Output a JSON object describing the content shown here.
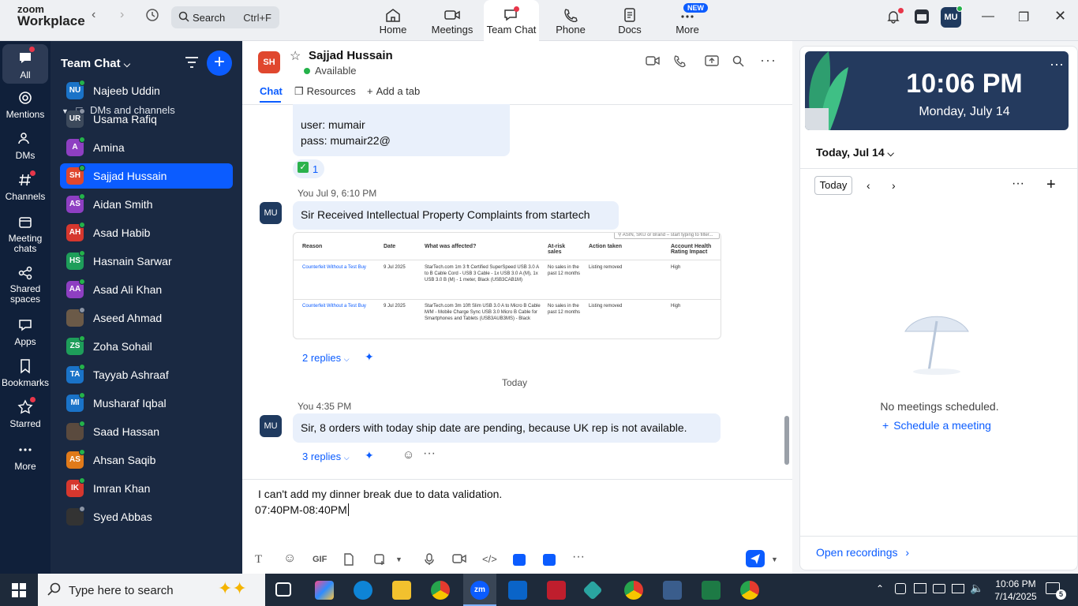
{
  "topbar": {
    "logo_top": "zoom",
    "logo_bottom": "Workplace",
    "search_label": "Search",
    "search_shortcut": "Ctrl+F",
    "tabs": [
      {
        "label": "Home",
        "icon": "home-icon"
      },
      {
        "label": "Meetings",
        "icon": "video-icon"
      },
      {
        "label": "Team Chat",
        "icon": "chat-icon"
      },
      {
        "label": "Phone",
        "icon": "phone-icon"
      },
      {
        "label": "Docs",
        "icon": "docs-icon"
      },
      {
        "label": "More",
        "icon": "more-dots-icon"
      }
    ],
    "new_badge": "NEW",
    "avatar": "MU"
  },
  "rail": [
    {
      "label": "All"
    },
    {
      "label": "Mentions"
    },
    {
      "label": "DMs"
    },
    {
      "label": "Channels"
    },
    {
      "label": "Meeting chats"
    },
    {
      "label": "Shared spaces"
    },
    {
      "label": "Apps"
    },
    {
      "label": "Bookmarks"
    },
    {
      "label": "Starred"
    },
    {
      "label": "More"
    }
  ],
  "sidebar": {
    "title": "Team Chat",
    "section": "DMs and channels",
    "contacts": [
      {
        "initials": "NU",
        "name": "Najeeb Uddin",
        "color": "#1a73c8"
      },
      {
        "initials": "UR",
        "name": "Usama Rafiq",
        "color": "#3d4a5c"
      },
      {
        "initials": "A",
        "name": "Amina",
        "color": "#8e3fc2"
      },
      {
        "initials": "SH",
        "name": "Sajjad Hussain",
        "color": "#e0472e"
      },
      {
        "initials": "AS",
        "name": "Aidan Smith",
        "color": "#8e3fc2"
      },
      {
        "initials": "AH",
        "name": "Asad Habib",
        "color": "#d6372e"
      },
      {
        "initials": "HS",
        "name": "Hasnain Sarwar",
        "color": "#1e9e5a"
      },
      {
        "initials": "AA",
        "name": "Asad Ali Khan",
        "color": "#8e3fc2"
      },
      {
        "initials": "",
        "name": "Aseed Ahmad",
        "color": "#6b5a48"
      },
      {
        "initials": "ZS",
        "name": "Zoha Sohail",
        "color": "#1e9e5a"
      },
      {
        "initials": "TA",
        "name": "Tayyab Ashraaf",
        "color": "#1a73c8"
      },
      {
        "initials": "MI",
        "name": "Musharaf Iqbal",
        "color": "#1a73c8"
      },
      {
        "initials": "",
        "name": "Saad Hassan",
        "color": "#5a4a3e"
      },
      {
        "initials": "AS",
        "name": "Ahsan Saqib",
        "color": "#e07a1a"
      },
      {
        "initials": "IK",
        "name": "Imran Khan",
        "color": "#d6372e"
      },
      {
        "initials": "",
        "name": "Syed Abbas",
        "color": "#333333"
      }
    ]
  },
  "chat": {
    "avatar": "SH",
    "name": "Sajjad Hussain",
    "status": "Available",
    "tabs": [
      "Chat",
      "Resources",
      "Add a tab"
    ],
    "msg0_line1": "user: mumair",
    "msg0_line2": "pass: mumair22@",
    "reaction_count": "1",
    "msg1_meta": "You Jul 9, 6:10 PM",
    "msg1_avatar": "MU",
    "msg1_text": "Sir Received Intellectual Property Complaints from startech",
    "attachment": {
      "search_hint": "ASIN, SKU or Brand – start typing to filter...",
      "headers": [
        "Reason",
        "Date",
        "What was affected?",
        "At-risk sales",
        "Action taken",
        "Account Health Rating Impact"
      ],
      "rows": [
        [
          "Counterfeit Without a Test Buy",
          "9 Jul 2025",
          "StarTech.com 1m 3 ft Certified SuperSpeed USB 3.0 A to B Cable Cord - USB 3 Cable - 1x USB 3.0 A (M), 1x USB 3.0 B (M) - 1 meter, Black (USB3CAB1M)",
          "No sales in the past 12 months",
          "Listing removed",
          "High"
        ],
        [
          "Counterfeit Without a Test Buy",
          "9 Jul 2025",
          "StarTech.com 3m 10ft Slim USB 3.0 A to Micro B Cable M/M - Mobile Charge Sync USB 3.0 Micro B Cable for Smartphones and Tablets (USB3AUB3MS) - Black",
          "No sales in the past 12 months",
          "Listing removed",
          "High"
        ]
      ]
    },
    "msg1_replies": "2 replies",
    "date_divider": "Today",
    "msg2_meta": "You 4:35 PM",
    "msg2_avatar": "MU",
    "msg2_text": "Sir, 8 orders with today ship date are pending, because UK rep is not available.",
    "msg2_replies": "3 replies",
    "composer_line1": "I can't add my dinner break due to data validation.",
    "composer_line2": "07:40PM-08:40PM",
    "composer_gif": "GIF"
  },
  "right": {
    "time": "10:06 PM",
    "date": "Monday, July 14",
    "date_header": "Today, Jul 14",
    "today_btn": "Today",
    "no_meetings": "No meetings scheduled.",
    "schedule": "Schedule a meeting",
    "open_recordings": "Open recordings"
  },
  "taskbar": {
    "search": "Type here to search",
    "time": "10:06 PM",
    "date": "7/14/2025",
    "notif_count": "5"
  },
  "colors": {
    "accent": "#0b5cff",
    "sidebar_bg": "#1a2942",
    "rail_bg": "#10203a",
    "bubble": "#e9f0fb",
    "presence": "#24b24a"
  }
}
